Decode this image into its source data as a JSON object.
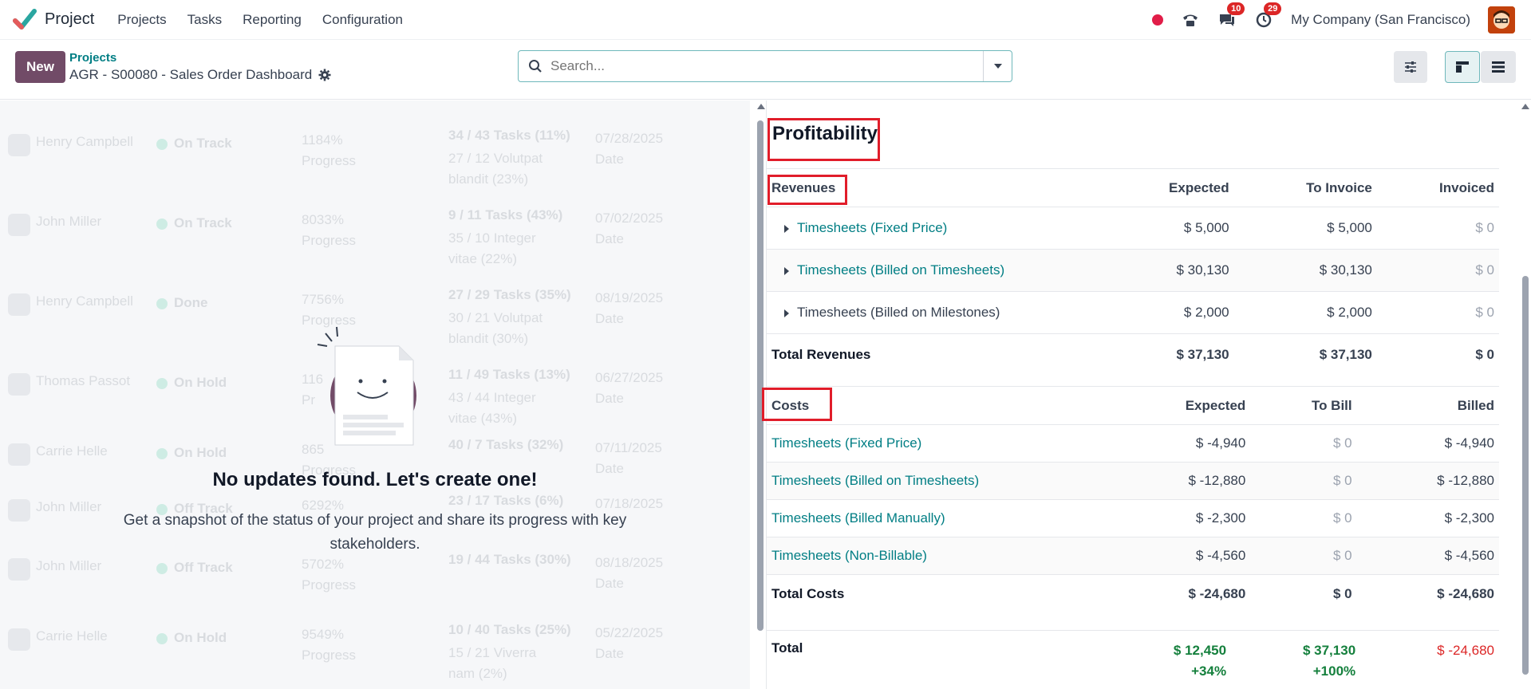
{
  "app": {
    "name": "Project",
    "menu": [
      "Projects",
      "Tasks",
      "Reporting",
      "Configuration"
    ],
    "systray": {
      "messages_count": "10",
      "activities_count": "29",
      "company": "My Company (San Francisco)"
    }
  },
  "control_panel": {
    "new_label": "New",
    "breadcrumb_parent": "Projects",
    "breadcrumb_current": "AGR - S00080 - Sales Order Dashboard",
    "search_placeholder": "Search..."
  },
  "updates": {
    "empty_title": "No updates found. Let's create one!",
    "empty_text": "Get a snapshot of the status of your project and share its progress with key stakeholders.",
    "ghost_rows": [
      {
        "name": "Henry Campbell",
        "status": "On Track",
        "progress": "1184%",
        "progress_label": "Progress",
        "tasks": "34 / 43 Tasks (11%)",
        "sub": "27 / 12 Volutpat blandit (23%)",
        "date": "07/28/2025",
        "date_label": "Date"
      },
      {
        "name": "John Miller",
        "status": "On Track",
        "progress": "8033%",
        "progress_label": "Progress",
        "tasks": "9 / 11 Tasks (43%)",
        "sub": "35 / 10 Integer vitae (22%)",
        "date": "07/02/2025",
        "date_label": "Date"
      },
      {
        "name": "Henry Campbell",
        "status": "Done",
        "progress": "7756%",
        "progress_label": "Progress",
        "tasks": "27 / 29 Tasks (35%)",
        "sub": "30 / 21 Volutpat blandit (30%)",
        "date": "08/19/2025",
        "date_label": "Date"
      },
      {
        "name": "Thomas Passot",
        "status": "On Hold",
        "progress": "116",
        "progress_label": "Pr",
        "tasks": "11 / 49 Tasks (13%)",
        "sub": "43 / 44 Integer vitae (43%)",
        "date": "06/27/2025",
        "date_label": "Date"
      },
      {
        "name": "Carrie Helle",
        "status": "On Hold",
        "progress": "865",
        "progress_label": "Progress",
        "tasks": "40 / 7 Tasks (32%)",
        "sub": "",
        "date": "07/11/2025",
        "date_label": "Date"
      },
      {
        "name": "John Miller",
        "status": "Off Track",
        "progress": "6292%",
        "progress_label": "",
        "tasks": "23 / 17 Tasks (6%)",
        "sub": "",
        "date": "07/18/2025",
        "date_label": ""
      },
      {
        "name": "John Miller",
        "status": "Off Track",
        "progress": "5702%",
        "progress_label": "Progress",
        "tasks": "19 / 44 Tasks (30%)",
        "sub": "",
        "date": "08/18/2025",
        "date_label": "Date"
      },
      {
        "name": "Carrie Helle",
        "status": "On Hold",
        "progress": "9549%",
        "progress_label": "Progress",
        "tasks": "10 / 40 Tasks (25%)",
        "sub": "15 / 21 Viverra nam (2%)",
        "date": "05/22/2025",
        "date_label": "Date"
      }
    ]
  },
  "profitability": {
    "title": "Profitability",
    "revenues": {
      "header": [
        "Revenues",
        "Expected",
        "To Invoice",
        "Invoiced"
      ],
      "rows": [
        {
          "label": "Timesheets (Fixed Price)",
          "expected": "$ 5,000",
          "to_invoice": "$ 5,000",
          "invoiced": "$ 0"
        },
        {
          "label": "Timesheets (Billed on Timesheets)",
          "expected": "$ 30,130",
          "to_invoice": "$ 30,130",
          "invoiced": "$ 0"
        },
        {
          "label": "Timesheets (Billed on Milestones)",
          "expected": "$ 2,000",
          "to_invoice": "$ 2,000",
          "invoiced": "$ 0"
        }
      ],
      "total": {
        "label": "Total Revenues",
        "expected": "$ 37,130",
        "to_invoice": "$ 37,130",
        "invoiced": "$ 0"
      }
    },
    "costs": {
      "header": [
        "Costs",
        "Expected",
        "To Bill",
        "Billed"
      ],
      "rows": [
        {
          "label": "Timesheets (Fixed Price)",
          "expected": "$ -4,940",
          "to_bill": "$ 0",
          "billed": "$ -4,940"
        },
        {
          "label": "Timesheets (Billed on Timesheets)",
          "expected": "$ -12,880",
          "to_bill": "$ 0",
          "billed": "$ -12,880"
        },
        {
          "label": "Timesheets (Billed Manually)",
          "expected": "$ -2,300",
          "to_bill": "$ 0",
          "billed": "$ -2,300"
        },
        {
          "label": "Timesheets (Non-Billable)",
          "expected": "$ -4,560",
          "to_bill": "$ 0",
          "billed": "$ -4,560"
        }
      ],
      "total": {
        "label": "Total Costs",
        "expected": "$ -24,680",
        "to_bill": "$ 0",
        "billed": "$ -24,680"
      }
    },
    "grand_total": {
      "label": "Total",
      "expected": "$ 12,450",
      "expected_pct": "+34%",
      "to_invoice": "$ 37,130",
      "to_invoice_pct": "+100%",
      "invoiced": "$ -24,680"
    }
  },
  "colors": {
    "brand": "#714b67",
    "link": "#017e84",
    "positive": "#15803d",
    "negative": "#dc2626",
    "highlight": "#e11d2a"
  }
}
